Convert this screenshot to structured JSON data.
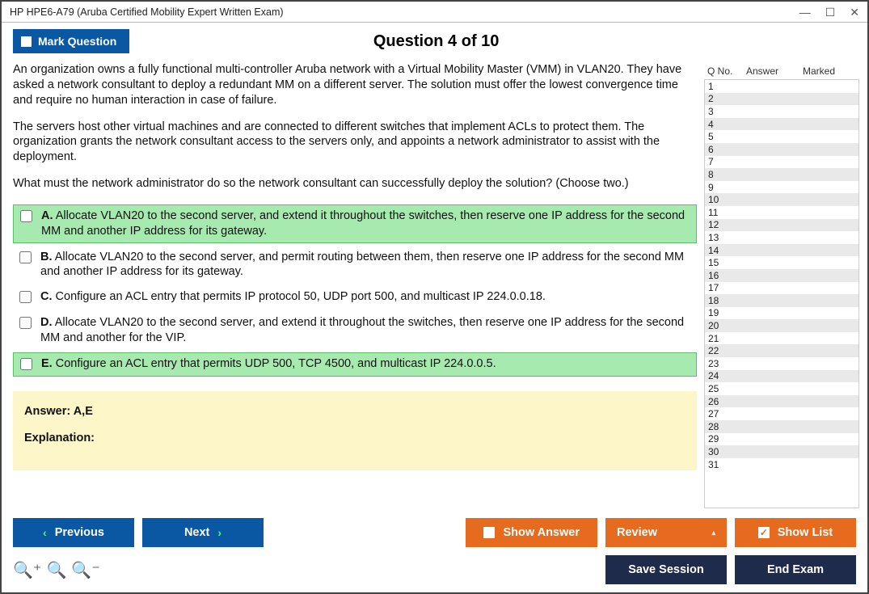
{
  "window": {
    "title": "HP HPE6-A79 (Aruba Certified Mobility Expert Written Exam)"
  },
  "header": {
    "mark_label": "Mark Question",
    "question_title": "Question 4 of 10"
  },
  "stem": {
    "p1": "An organization owns a fully functional multi-controller Aruba network with a Virtual Mobility Master (VMM) in VLAN20. They have asked a network consultant to deploy a redundant MM on a different server. The solution must offer the lowest convergence time and require no human interaction in case of failure.",
    "p2": "The servers host other virtual machines and are connected to different switches that implement ACLs to protect them. The organization grants the network consultant access to the servers only, and appoints a network administrator to assist with the deployment.",
    "p3": "What must the network administrator do so the network consultant can successfully deploy the solution? (Choose two.)"
  },
  "options": [
    {
      "letter": "A.",
      "text": "Allocate VLAN20 to the second server, and extend it throughout the switches, then reserve one IP address for the second MM and another IP address for its gateway.",
      "correct": true
    },
    {
      "letter": "B.",
      "text": "Allocate VLAN20 to the second server, and permit routing between them, then reserve one IP address for the second MM and another IP address for its gateway.",
      "correct": false
    },
    {
      "letter": "C.",
      "text": "Configure an ACL entry that permits IP protocol 50, UDP port 500, and multicast IP 224.0.0.18.",
      "correct": false
    },
    {
      "letter": "D.",
      "text": "Allocate VLAN20 to the second server, and extend it throughout the switches, then reserve one IP address for the second MM and another for the VIP.",
      "correct": false
    },
    {
      "letter": "E.",
      "text": "Configure an ACL entry that permits UDP 500, TCP 4500, and multicast IP 224.0.0.5.",
      "correct": true
    }
  ],
  "answer": {
    "label": "Answer: A,E",
    "explanation_label": "Explanation:"
  },
  "sidebar": {
    "h_q": "Q No.",
    "h_a": "Answer",
    "h_m": "Marked",
    "rows": [
      1,
      2,
      3,
      4,
      5,
      6,
      7,
      8,
      9,
      10,
      11,
      12,
      13,
      14,
      15,
      16,
      17,
      18,
      19,
      20,
      21,
      22,
      23,
      24,
      25,
      26,
      27,
      28,
      29,
      30,
      31
    ]
  },
  "footer": {
    "previous": "Previous",
    "next": "Next",
    "show_answer": "Show Answer",
    "review": "Review",
    "show_list": "Show List",
    "save_session": "Save Session",
    "end_exam": "End Exam"
  }
}
